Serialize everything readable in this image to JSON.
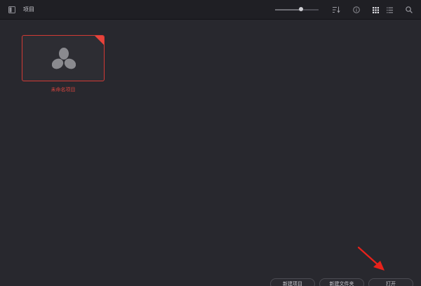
{
  "toolbar": {
    "title": "项目",
    "zoom_slider_value": 0.6,
    "icons": [
      "sidebar-toggle-icon",
      "sort-icon",
      "info-icon",
      "grid-view-icon",
      "list-view-icon",
      "search-icon"
    ]
  },
  "projects": [
    {
      "name": "未命名项目",
      "selected": true
    }
  ],
  "buttons": {
    "new_project": "新建项目",
    "new_folder": "新建文件夹",
    "open": "打开"
  },
  "colors": {
    "background": "#28282e",
    "toolbar": "#1f1f24",
    "accent_red": "#d9453f",
    "annotation_arrow": "#e8221b"
  }
}
